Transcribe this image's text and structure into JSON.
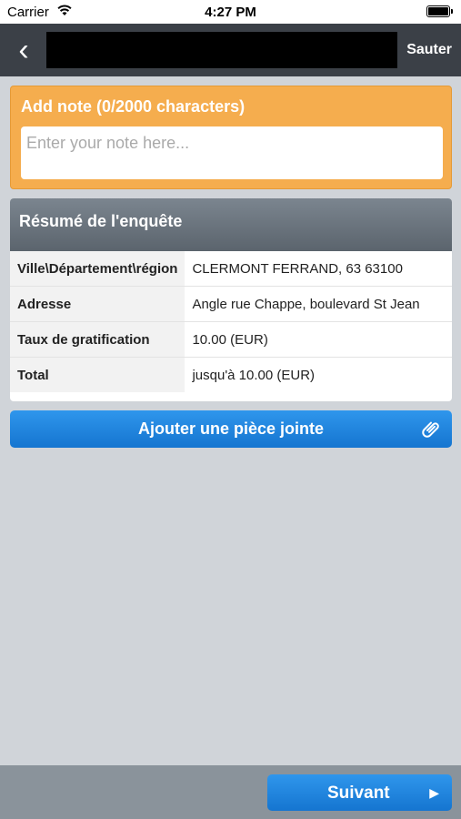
{
  "status_bar": {
    "carrier": "Carrier",
    "time": "4:27 PM"
  },
  "nav": {
    "back_icon": "chevron-left-icon",
    "back_glyph": "‹",
    "skip_label": "Sauter"
  },
  "note": {
    "title": "Add note (0/2000 characters)",
    "placeholder": "Enter your note here...",
    "value": ""
  },
  "summary": {
    "title": "Résumé de l'enquête",
    "rows": [
      {
        "label": "Ville\\Département\\région",
        "value": "CLERMONT FERRAND, 63 63100"
      },
      {
        "label": "Adresse",
        "value": "Angle rue Chappe, boulevard St Jean"
      },
      {
        "label": "Taux de gratification",
        "value": "10.00 (EUR)"
      },
      {
        "label": "Total",
        "value": "jusqu'à 10.00 (EUR)"
      }
    ]
  },
  "attach": {
    "label": "Ajouter une pièce jointe",
    "icon": "paperclip-icon"
  },
  "footer": {
    "next_label": "Suivant",
    "next_icon": "play-arrow-icon",
    "next_glyph": "▶"
  },
  "colors": {
    "note_bg": "#f5ad4e",
    "header_bg": "#3b4047",
    "button_blue": "#1f85dd",
    "page_bg": "#d0d4d9",
    "footer_bg": "#8a939b"
  }
}
